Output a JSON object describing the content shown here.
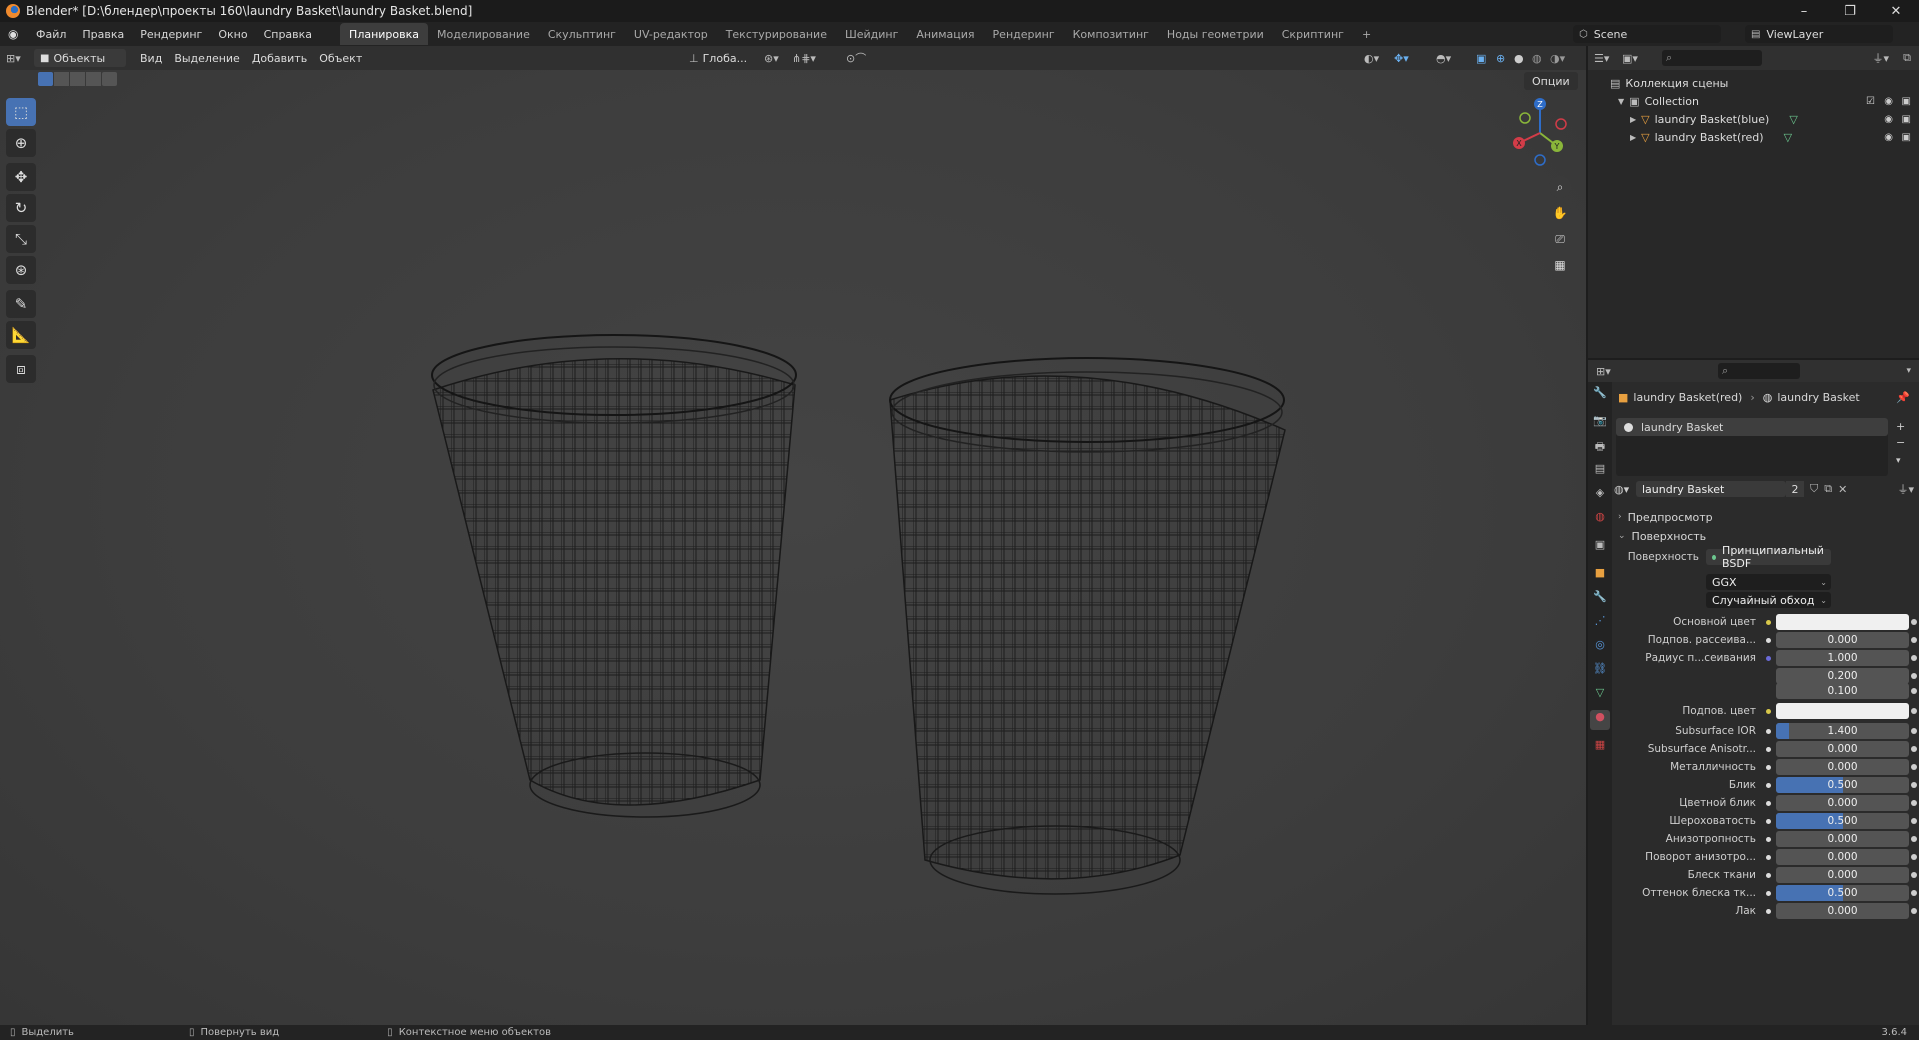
{
  "window": {
    "title": "Blender* [D:\\блендер\\проекты 160\\laundry Basket\\laundry Basket.blend]",
    "minimize": "–",
    "restore": "❐",
    "close": "✕"
  },
  "menu": [
    "Файл",
    "Правка",
    "Рендеринг",
    "Окно",
    "Справка"
  ],
  "workspaces": [
    "Планировка",
    "Моделирование",
    "Скульптинг",
    "UV-редактор",
    "Текстурирование",
    "Шейдинг",
    "Анимация",
    "Рендеринг",
    "Композитинг",
    "Ноды геометрии",
    "Скриптинг"
  ],
  "workspace_add": "+",
  "scene": {
    "scene_name": "Scene",
    "view_layer": "ViewLayer"
  },
  "viewport_header": {
    "mode": "Объекты",
    "menus": [
      "Вид",
      "Выделение",
      "Добавить",
      "Объект"
    ],
    "orientation": "Глоба...",
    "options": "Опции"
  },
  "gizmo": {
    "z": "Z",
    "y": "Y",
    "x": "X"
  },
  "outliner": {
    "root": "Коллекция сцены",
    "collection": "Collection",
    "items": [
      "laundry Basket(blue)",
      "laundry Basket(red)"
    ]
  },
  "properties": {
    "breadcrumb_object": "laundry Basket(red)",
    "breadcrumb_material": "laundry Basket",
    "slot_name": "laundry Basket",
    "material_name": "laundry Basket",
    "users": "2",
    "panel_preview": "Предпросмотр",
    "panel_surface": "Поверхность",
    "surface_label": "Поверхность",
    "surface_value": "Принципиальный BSDF",
    "distribution": "GGX",
    "subsurface_method": "Случайный обход",
    "rows": [
      {
        "label": "Основной цвет",
        "type": "color",
        "color": "#f0f0f0",
        "dot": "#d8c84a"
      },
      {
        "label": "Подпов. рассеива...",
        "value": "0.000",
        "fill": 0
      },
      {
        "label": "Радиус п...сеивания",
        "value": "1.000",
        "fill": 0,
        "dot": "#6a6ad8"
      },
      {
        "label": "",
        "value": "0.200",
        "fill": 0,
        "nodot": true
      },
      {
        "label": "",
        "value": "0.100",
        "fill": 0,
        "nodot": true
      },
      {
        "label": "Подпов. цвет",
        "type": "color",
        "color": "#f0f0f0",
        "dot": "#d8c84a"
      },
      {
        "label": "Subsurface IOR",
        "value": "1.400",
        "fill": 0.1
      },
      {
        "label": "Subsurface Anisotr...",
        "value": "0.000",
        "fill": 0
      },
      {
        "label": "Металличность",
        "value": "0.000",
        "fill": 0
      },
      {
        "label": "Блик",
        "value": "0.500",
        "fill": 0.5
      },
      {
        "label": "Цветной блик",
        "value": "0.000",
        "fill": 0
      },
      {
        "label": "Шероховатость",
        "value": "0.500",
        "fill": 0.5
      },
      {
        "label": "Анизотропность",
        "value": "0.000",
        "fill": 0
      },
      {
        "label": "Поворот анизотро...",
        "value": "0.000",
        "fill": 0
      },
      {
        "label": "Блеск ткани",
        "value": "0.000",
        "fill": 0
      },
      {
        "label": "Оттенок блеска тк...",
        "value": "0.500",
        "fill": 0.5
      },
      {
        "label": "Лак",
        "value": "0.000",
        "fill": 0
      }
    ]
  },
  "status": {
    "select": "Выделить",
    "rotate": "Повернуть вид",
    "context": "Контекстное меню объектов",
    "version": "3.6.4"
  }
}
